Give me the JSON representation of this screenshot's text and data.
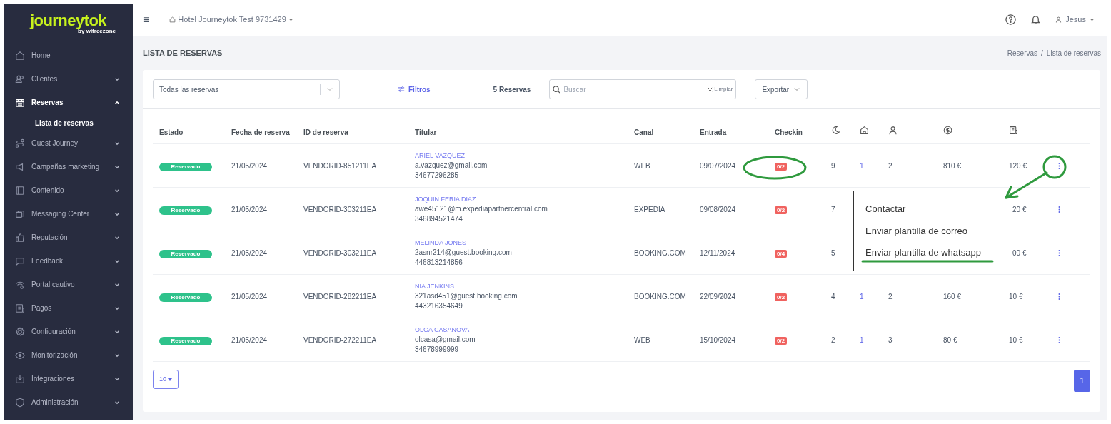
{
  "logo": {
    "name": "journeytok",
    "tagline": "by wifreezone"
  },
  "header": {
    "menu_icon": "≡",
    "hotel": "Hotel Journeytok Test 9731429",
    "user": "Jesus"
  },
  "sidebar": {
    "items": [
      {
        "label": "Home",
        "selected": false
      },
      {
        "label": "Clientes",
        "selected": false,
        "expanded": false
      },
      {
        "label": "Reservas",
        "selected": true,
        "expanded": true,
        "children": [
          {
            "label": "Lista de reservas",
            "selected": true
          }
        ]
      },
      {
        "label": "Guest Journey",
        "selected": false,
        "expanded": false
      },
      {
        "label": "Campañas marketing",
        "selected": false,
        "expanded": false
      },
      {
        "label": "Contenido",
        "selected": false,
        "expanded": false
      },
      {
        "label": "Messaging Center",
        "selected": false,
        "expanded": false
      },
      {
        "label": "Reputación",
        "selected": false,
        "expanded": false
      },
      {
        "label": "Feedback",
        "selected": false,
        "expanded": false
      },
      {
        "label": "Portal cautivo",
        "selected": false,
        "expanded": false
      },
      {
        "label": "Pagos",
        "selected": false,
        "expanded": false
      },
      {
        "label": "Configuración",
        "selected": false,
        "expanded": false
      },
      {
        "label": "Monitorización",
        "selected": false,
        "expanded": false
      },
      {
        "label": "Integraciones",
        "selected": false,
        "expanded": false
      },
      {
        "label": "Administración",
        "selected": false,
        "expanded": false
      }
    ]
  },
  "page_title": "LISTA DE RESERVAS",
  "breadcrumb": [
    "Reservas",
    "Lista de reservas"
  ],
  "breadcrumb_separator": "/",
  "toolbar": {
    "select": {
      "value": "Todas las reservas"
    },
    "filters": "Filtros",
    "count": "5 Reservas",
    "search": {
      "placeholder": "Buscar",
      "clear": "Limpiar"
    },
    "export": "Exportar"
  },
  "table": {
    "columns": [
      "Estado",
      "Fecha de reserva",
      "ID de reserva",
      "Titular",
      "Canal",
      "Entrada",
      "Checkin"
    ],
    "rows": [
      {
        "status": "Reservado",
        "date": "21/05/2024",
        "id": "VENDORID-851211EA",
        "name": "ARIEL VAZQUEZ",
        "email": "a.vazquez@gmail.com",
        "phone": "34677296285",
        "channel": "WEB",
        "arrival": "09/07/2024",
        "checkin": "0/2",
        "nights": "9",
        "rooms": "1",
        "guests": "2",
        "price": "810 €",
        "tax": "120 €"
      },
      {
        "status": "Reservado",
        "date": "21/05/2024",
        "id": "VENDORID-303211EA",
        "name": "JOQUIN FERIA DIAZ",
        "email": "awe45121@m.expediapartnercentral.com",
        "phone": "346894521474",
        "channel": "EXPEDIA",
        "arrival": "09/08/2024",
        "checkin": "0/2",
        "nights": "7",
        "tax": "20 €"
      },
      {
        "status": "Reservado",
        "date": "21/05/2024",
        "id": "VENDORID-303211EA",
        "name": "MELINDA JONES",
        "email": "2asnr214@guest.booking.com",
        "phone": "446813214856",
        "channel": "BOOKING.COM",
        "arrival": "12/11/2024",
        "checkin": "0/4",
        "nights": "5",
        "tax": "00 €"
      },
      {
        "status": "Reservado",
        "date": "21/05/2024",
        "id": "VENDORID-282211EA",
        "name": "NIA JENKINS",
        "email": "321asd451@guest.booking.com",
        "phone": "443216354649",
        "channel": "BOOKING.COM",
        "arrival": "22/09/2024",
        "checkin": "0/2",
        "nights": "4",
        "rooms": "1",
        "guests": "2",
        "price": "160 €",
        "tax": "10 €"
      },
      {
        "status": "Reservado",
        "date": "21/05/2024",
        "id": "VENDORID-272211EA",
        "name": "OLGA CASANOVA",
        "email": "olcasa@gmail.com",
        "phone": "34678999999",
        "channel": "WEB",
        "arrival": "15/10/2024",
        "checkin": "0/2",
        "nights": "2",
        "rooms": "1",
        "guests": "3",
        "price": "80 €",
        "tax": "10 €"
      }
    ]
  },
  "row_menu": {
    "items": [
      "Contactar",
      "Enviar plantilla de correo",
      "Enviar plantilla de whatsapp"
    ]
  },
  "pagination": {
    "page_size": "10",
    "pages": [
      {
        "label": "1",
        "selected": true
      }
    ]
  }
}
